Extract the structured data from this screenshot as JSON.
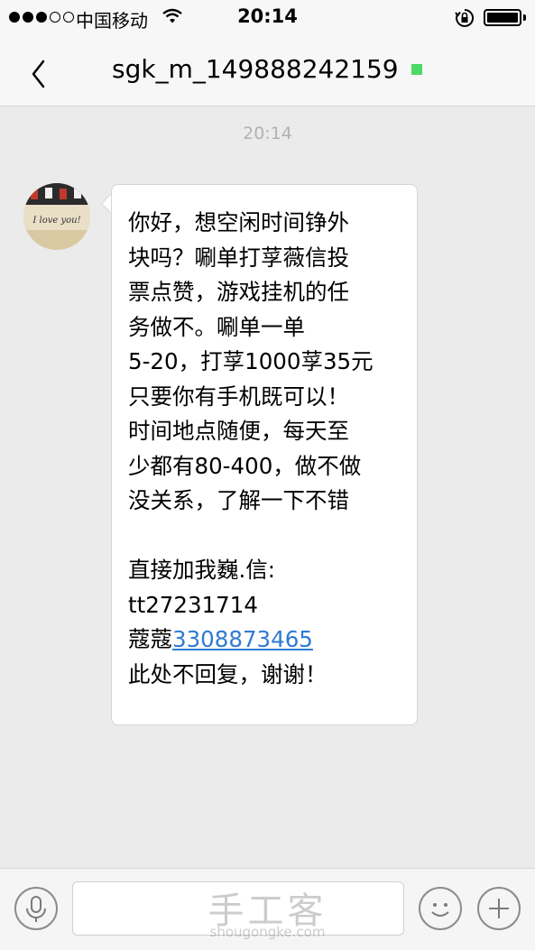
{
  "status_bar": {
    "carrier": "中国移动",
    "time": "20:14",
    "signal_bars": 3,
    "signal_total": 5
  },
  "nav": {
    "title": "sgk_m_149888242159",
    "online_color": "#4cd964"
  },
  "chat": {
    "timestamp": "20:14",
    "avatar_caption": "I love you!",
    "message_lines": [
      "你好，想空闲时间铮外",
      "块吗？唰单打莩薇信投",
      "票点赞，游戏挂机的任",
      "务做不。唰单一单",
      "5-20，打莩1000莩35元",
      "只要你有手机既可以！",
      "时间地点随便，每天至",
      "少都有80-400，做不做",
      "没关系，了解一下不错"
    ],
    "contact_lines": [
      "直接加我巍.信:",
      "tt27231714"
    ],
    "qq_prefix": "蔻蔻",
    "phone_number": "3308873465",
    "final_line": "此处不回复，谢谢！",
    "link_color": "#2f7bd3"
  },
  "input_bar": {
    "voice_icon": "microphone-icon",
    "emoji_icon": "smile-icon",
    "add_icon": "plus-icon"
  },
  "watermark": {
    "cn": "手工客",
    "en": "shougongke.com"
  }
}
